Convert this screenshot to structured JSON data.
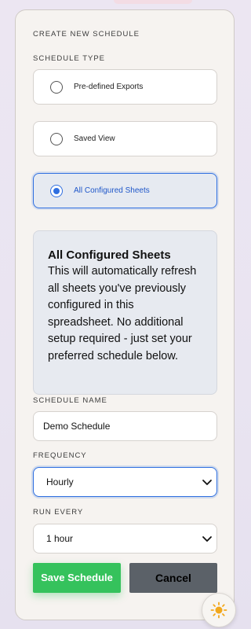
{
  "panel": {
    "title": "CREATE NEW SCHEDULE",
    "schedule_type_label": "SCHEDULE TYPE",
    "options": [
      {
        "label": "Pre-defined Exports",
        "selected": false
      },
      {
        "label": "Saved View",
        "selected": false
      },
      {
        "label": "All Configured Sheets",
        "selected": true
      }
    ],
    "info": {
      "title": "All Configured Sheets",
      "text": "This will automatically refresh all sheets you've previously configured in this spreadsheet. No additional setup required - just set your preferred schedule below."
    },
    "schedule_name": {
      "label": "SCHEDULE NAME",
      "value": "Demo Schedule"
    },
    "frequency": {
      "label": "FREQUENCY",
      "value": "Hourly"
    },
    "run_every": {
      "label": "RUN EVERY",
      "value": "1 hour"
    },
    "buttons": {
      "save": "Save Schedule",
      "cancel": "Cancel"
    }
  },
  "theme_toggle": {
    "icon": "sun-icon"
  },
  "colors": {
    "accent": "#2f6fe0",
    "save": "#35c25c",
    "cancel": "#5b6168"
  }
}
